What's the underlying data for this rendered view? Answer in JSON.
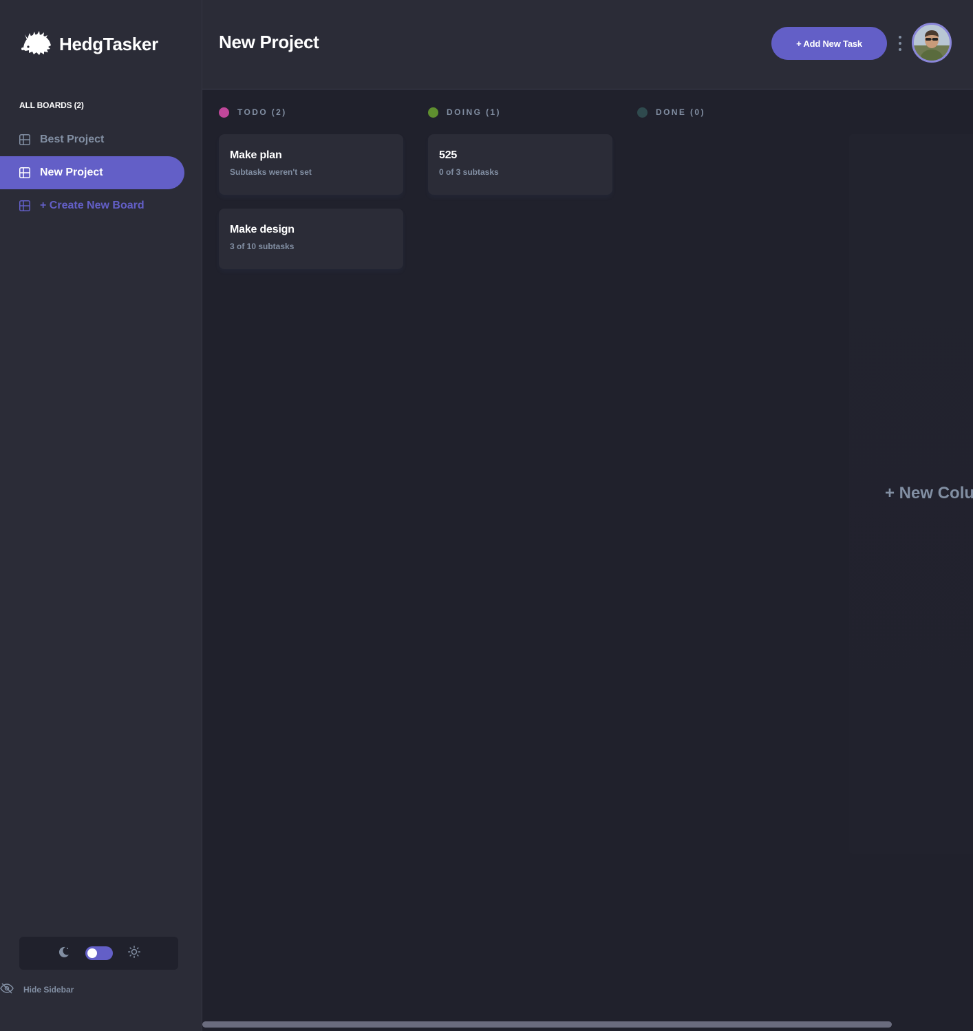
{
  "app": {
    "name": "HedgTasker"
  },
  "sidebar": {
    "boards_heading": "ALL BOARDS (2)",
    "items": [
      {
        "label": "Best Project",
        "active": false
      },
      {
        "label": "New Project",
        "active": true
      }
    ],
    "create_label": "+ Create New Board",
    "theme": {
      "mode": "dark",
      "icons": [
        "moon-icon",
        "sun-icon"
      ]
    },
    "hide_label": "Hide Sidebar"
  },
  "header": {
    "title": "New Project",
    "add_task_label": "+ Add New Task"
  },
  "board": {
    "columns": [
      {
        "title": "TODO (2)",
        "color": "#c0479a",
        "cards": [
          {
            "title": "Make plan",
            "subtitle": "Subtasks weren't set"
          },
          {
            "title": "Make design",
            "subtitle": "3 of 10 subtasks"
          }
        ]
      },
      {
        "title": "DOING (1)",
        "color": "#5f8f2f",
        "cards": [
          {
            "title": "525",
            "subtitle": "0 of 3 subtasks"
          }
        ]
      },
      {
        "title": "DONE (0)",
        "color": "#2f4a4e",
        "cards": []
      }
    ],
    "new_column_label": "+ New Column"
  },
  "colors": {
    "accent": "#635fc7",
    "sidebar_bg": "#2b2c37",
    "board_bg": "#20212c",
    "muted_text": "#828fa3"
  }
}
